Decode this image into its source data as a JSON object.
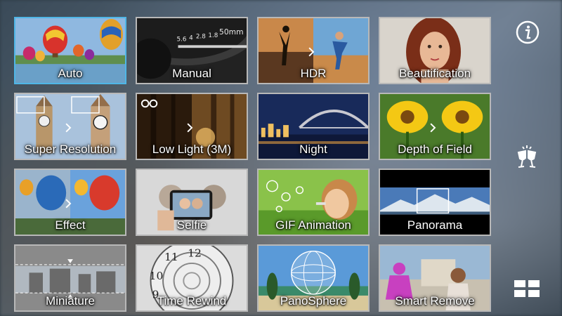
{
  "modes": [
    {
      "label": "Auto"
    },
    {
      "label": "Manual"
    },
    {
      "label": "HDR"
    },
    {
      "label": "Beautification"
    },
    {
      "label": "Super Resolution"
    },
    {
      "label": "Low Light (3M)"
    },
    {
      "label": "Night"
    },
    {
      "label": "Depth of Field"
    },
    {
      "label": "Effect"
    },
    {
      "label": "Selfie"
    },
    {
      "label": "GIF Animation"
    },
    {
      "label": "Panorama"
    },
    {
      "label": "Miniature"
    },
    {
      "label": "Time Rewind"
    },
    {
      "label": "PanoSphere"
    },
    {
      "label": "Smart Remove"
    }
  ],
  "selected_mode": "Auto",
  "colors": {
    "selection": "#4fb6e6",
    "tile_border": "#b8b8b8"
  },
  "icons": {
    "info": "info-icon",
    "cheers": "cheers-icon",
    "layout": "grid-layout-icon"
  }
}
